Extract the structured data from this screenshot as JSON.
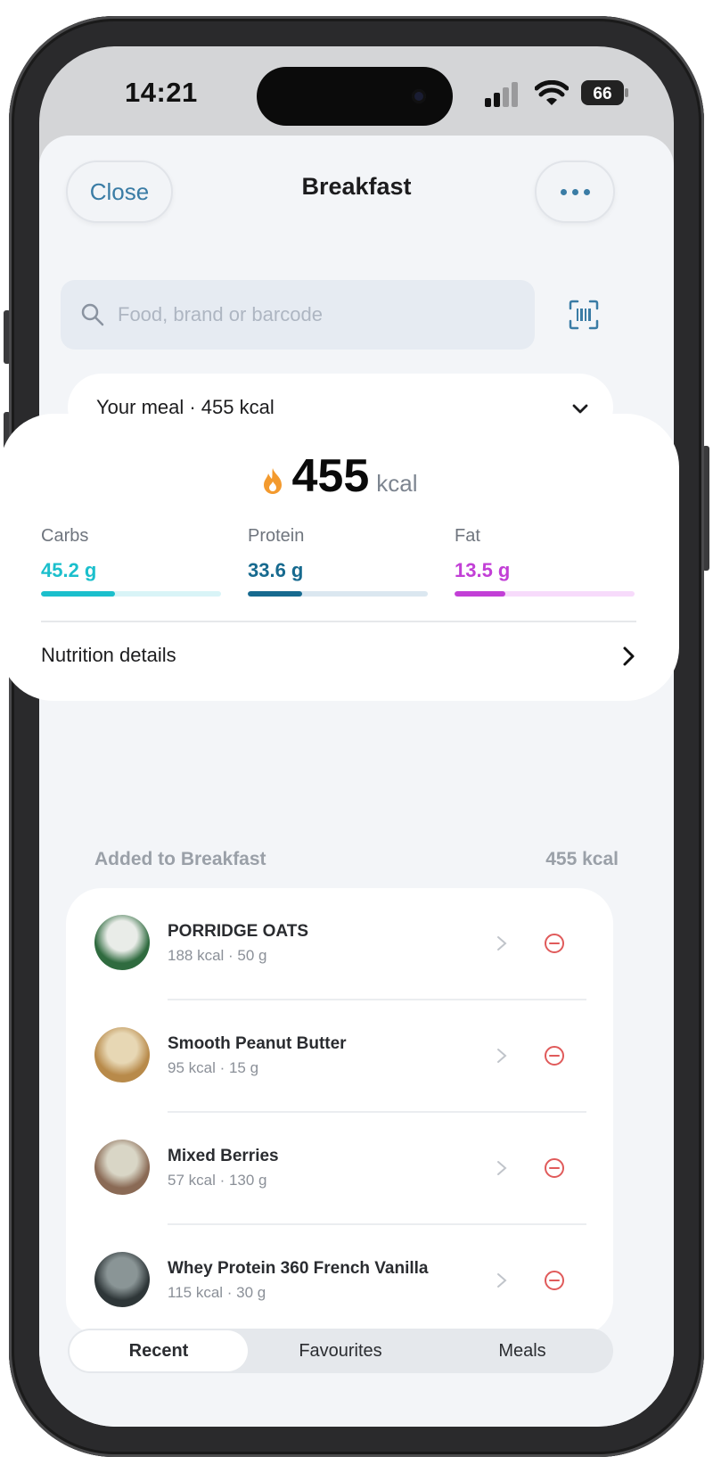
{
  "status_bar": {
    "time": "14:21",
    "battery": "66"
  },
  "header": {
    "close_label": "Close",
    "title": "Breakfast",
    "more_icon": "ellipsis-icon"
  },
  "search": {
    "placeholder": "Food, brand or barcode"
  },
  "meal_selector": {
    "label": "Your meal · 455 kcal"
  },
  "summary": {
    "calories": "455",
    "unit": "kcal",
    "macros": [
      {
        "label": "Carbs",
        "value": "45.2 g",
        "progress": 0.41,
        "color": "#1bbfcc",
        "track": "#d9f4f7"
      },
      {
        "label": "Protein",
        "value": "33.6 g",
        "progress": 0.3,
        "color": "#176a8f",
        "track": "#dbe7f0"
      },
      {
        "label": "Fat",
        "value": "13.5 g",
        "progress": 0.28,
        "color": "#c23fd6",
        "track": "#f7dbfb"
      }
    ],
    "details_label": "Nutrition details"
  },
  "added": {
    "title": "Added to Breakfast",
    "total": "455 kcal"
  },
  "items": [
    {
      "name": "PORRIDGE OATS",
      "detail": "188 kcal · 50 g",
      "colors": [
        "#2f6b3f",
        "#e9ece8"
      ]
    },
    {
      "name": "Smooth Peanut Butter",
      "detail": "95 kcal · 15 g",
      "colors": [
        "#b88a4a",
        "#e7d7b4"
      ]
    },
    {
      "name": "Mixed Berries",
      "detail": "57 kcal · 130 g",
      "colors": [
        "#8a6a55",
        "#d9d6c6"
      ]
    },
    {
      "name": "Whey Protein 360 French Vanilla",
      "detail": "115 kcal · 30 g",
      "colors": [
        "#2e3638",
        "#8a9596"
      ]
    }
  ],
  "tabs": [
    {
      "label": "Recent",
      "active": true
    },
    {
      "label": "Favourites",
      "active": false
    },
    {
      "label": "Meals",
      "active": false
    }
  ]
}
